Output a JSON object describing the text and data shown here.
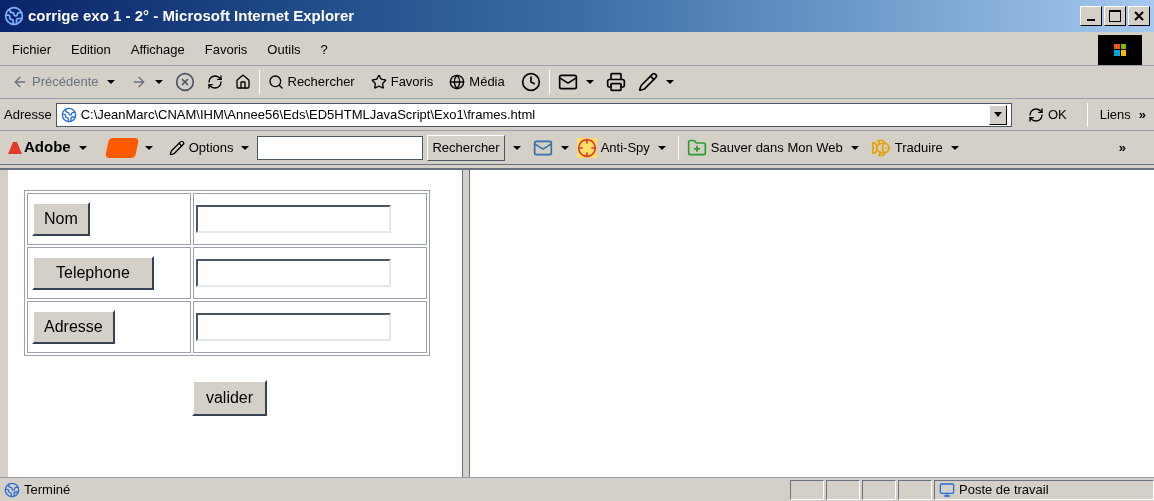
{
  "window": {
    "title": "corrige exo 1 - 2° - Microsoft Internet Explorer"
  },
  "menu": [
    "Fichier",
    "Edition",
    "Affichage",
    "Favoris",
    "Outils",
    "?"
  ],
  "toolbar": {
    "back": "Précédente",
    "search": "Rechercher",
    "favorites": "Favoris",
    "media": "Média"
  },
  "address": {
    "label": "Adresse",
    "value": "C:\\JeanMarc\\CNAM\\IHM\\Annee56\\Eds\\ED5HTMLJavaScript\\Exo1\\frames.html",
    "go": "OK",
    "links": "Liens",
    "links_more": "»"
  },
  "adobe_bar": {
    "adobe": "Adobe",
    "options": "Options",
    "search_button": "Rechercher",
    "antispy": "Anti-Spy",
    "save": "Sauver dans Mon Web",
    "translate": "Traduire",
    "more": "»"
  },
  "form": {
    "rows": [
      {
        "label": "Nom"
      },
      {
        "label": "Telephone"
      },
      {
        "label": "Adresse"
      }
    ],
    "submit": "valider"
  },
  "status_bar": {
    "text": "Terminé",
    "zone": "Poste de travail"
  }
}
